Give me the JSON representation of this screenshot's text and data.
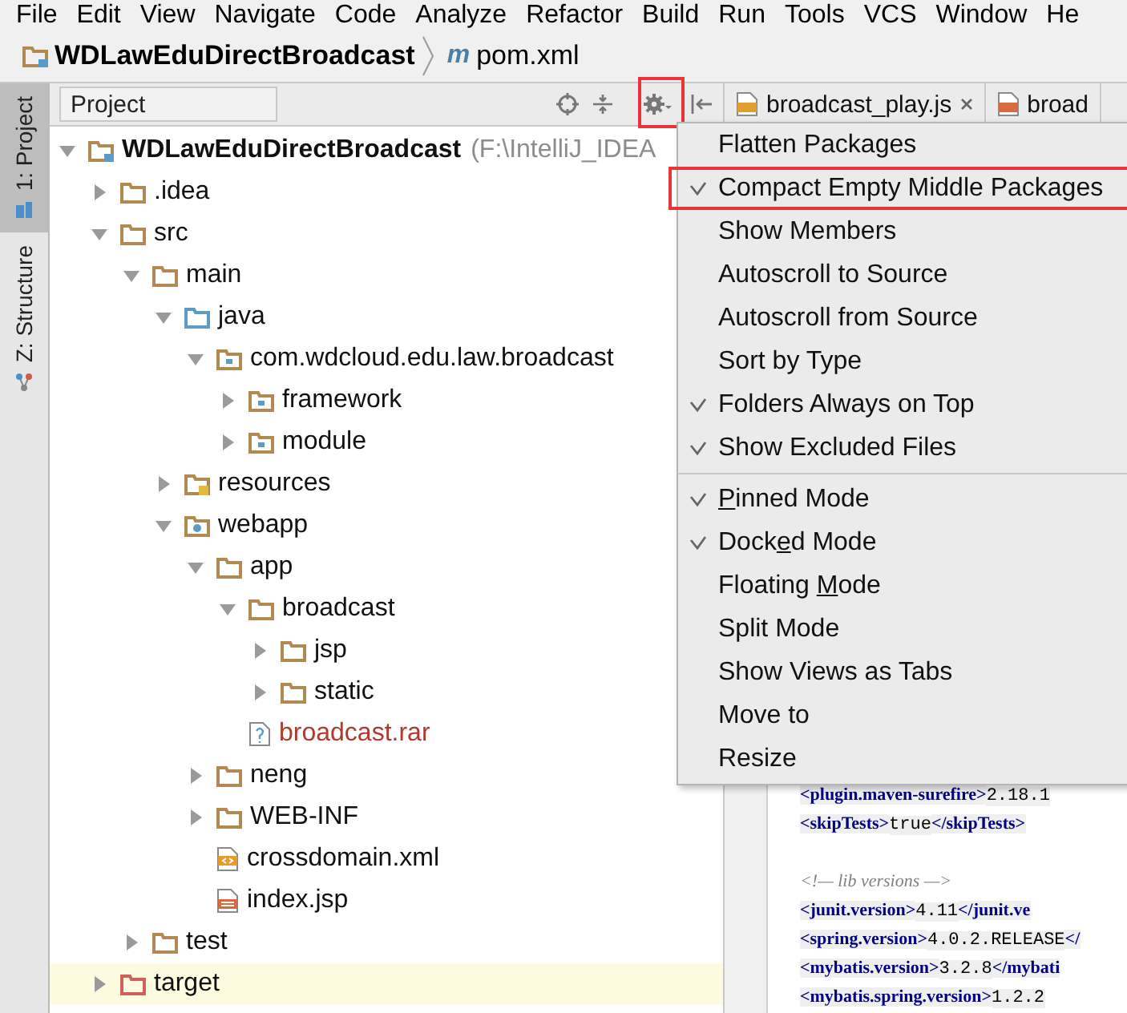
{
  "menu_bar": [
    "File",
    "Edit",
    "View",
    "Navigate",
    "Code",
    "Analyze",
    "Refactor",
    "Build",
    "Run",
    "Tools",
    "VCS",
    "Window",
    "He"
  ],
  "breadcrumbs": [
    {
      "label": "WDLawEduDirectBroadcast"
    },
    {
      "label": "pom.xml",
      "badge": "m"
    }
  ],
  "tool_strip": [
    {
      "label": "1: Project",
      "selected": true
    },
    {
      "label": "Z: Structure",
      "selected": false
    }
  ],
  "project_panel": {
    "view_selector": "Project",
    "gear_highlighted": true,
    "tree": [
      {
        "name": "WDLawEduDirectBroadcast",
        "path": "(F:\\IntelliJ_IDEA",
        "kind": "module",
        "expanded": true,
        "selected": false,
        "children": [
          {
            "name": ".idea",
            "kind": "folder",
            "expanded": false,
            "selected": false
          },
          {
            "name": "src",
            "kind": "folder",
            "expanded": true,
            "selected": false,
            "children": [
              {
                "name": "main",
                "kind": "folder",
                "expanded": true,
                "selected": false,
                "children": [
                  {
                    "name": "java",
                    "kind": "source",
                    "expanded": true,
                    "selected": false,
                    "children": [
                      {
                        "name": "com.wdcloud.edu.law.broadcast",
                        "kind": "package",
                        "expanded": true,
                        "selected": false,
                        "children": [
                          {
                            "name": "framework",
                            "kind": "package",
                            "expanded": false,
                            "selected": false
                          },
                          {
                            "name": "module",
                            "kind": "package",
                            "expanded": false,
                            "selected": false
                          }
                        ]
                      }
                    ]
                  },
                  {
                    "name": "resources",
                    "kind": "resources",
                    "expanded": false,
                    "selected": false
                  },
                  {
                    "name": "webapp",
                    "kind": "web",
                    "expanded": true,
                    "selected": false,
                    "children": [
                      {
                        "name": "app",
                        "kind": "folder",
                        "expanded": true,
                        "selected": false,
                        "children": [
                          {
                            "name": "broadcast",
                            "kind": "folder",
                            "expanded": true,
                            "selected": false,
                            "children": [
                              {
                                "name": "jsp",
                                "kind": "folder",
                                "expanded": false,
                                "selected": false
                              },
                              {
                                "name": "static",
                                "kind": "folder",
                                "expanded": false,
                                "selected": false
                              }
                            ]
                          },
                          {
                            "name": "broadcast.rar",
                            "kind": "unknown",
                            "color": "#b03a2e",
                            "selected": false
                          }
                        ]
                      },
                      {
                        "name": "neng",
                        "kind": "folder",
                        "expanded": false,
                        "selected": false
                      },
                      {
                        "name": "WEB-INF",
                        "kind": "folder",
                        "expanded": false,
                        "selected": false
                      },
                      {
                        "name": "crossdomain.xml",
                        "kind": "xml",
                        "selected": false
                      },
                      {
                        "name": "index.jsp",
                        "kind": "jsp",
                        "selected": false
                      }
                    ]
                  }
                ]
              },
              {
                "name": "test",
                "kind": "folder",
                "expanded": false,
                "selected": false
              }
            ]
          },
          {
            "name": "target",
            "kind": "excluded",
            "expanded": false,
            "selected": true
          }
        ]
      }
    ]
  },
  "editor_tabs": [
    {
      "label": "broadcast_play.js",
      "kind": "js",
      "closable": true
    },
    {
      "label": "broad",
      "kind": "jsp",
      "closable": false
    }
  ],
  "popup_menu": [
    {
      "kind": "item",
      "label": "Flatten Packages",
      "checked": false,
      "highlighted": false
    },
    {
      "kind": "item",
      "label": "Compact Empty Middle Packages",
      "checked": true,
      "highlighted": true
    },
    {
      "kind": "item",
      "label": "Show Members",
      "checked": false,
      "highlighted": false
    },
    {
      "kind": "item",
      "label": "Autoscroll to Source",
      "checked": false,
      "highlighted": false
    },
    {
      "kind": "item",
      "label": "Autoscroll from Source",
      "checked": false,
      "highlighted": false
    },
    {
      "kind": "item",
      "label": "Sort by Type",
      "checked": false,
      "highlighted": false
    },
    {
      "kind": "item",
      "label": "Folders Always on Top",
      "checked": true,
      "highlighted": false
    },
    {
      "kind": "item",
      "label": "Show Excluded Files",
      "checked": true,
      "highlighted": false
    },
    {
      "kind": "separator"
    },
    {
      "kind": "item",
      "label_parts": [
        {
          "text": "P",
          "underline": true
        },
        {
          "text": "inned Mode"
        }
      ],
      "checked": true,
      "highlighted": false
    },
    {
      "kind": "item",
      "label_parts": [
        {
          "text": "Dock"
        },
        {
          "text": "e",
          "underline": true
        },
        {
          "text": "d Mode"
        }
      ],
      "checked": true,
      "highlighted": false
    },
    {
      "kind": "item",
      "label_parts": [
        {
          "text": "Floating "
        },
        {
          "text": "M",
          "underline": true
        },
        {
          "text": "ode"
        }
      ],
      "checked": false,
      "highlighted": false
    },
    {
      "kind": "item",
      "label": "Split Mode",
      "checked": false,
      "highlighted": false
    },
    {
      "kind": "item",
      "label": "Show Views as Tabs",
      "checked": false,
      "highlighted": false
    },
    {
      "kind": "item",
      "label": "Move to",
      "checked": false,
      "highlighted": false
    },
    {
      "kind": "item",
      "label": "Resize",
      "checked": false,
      "highlighted": false
    }
  ],
  "code_lines": [
    {
      "segments": [
        {
          "kind": "tag",
          "text": "<plugin.maven-surefire>"
        },
        {
          "kind": "value",
          "text": "2.18.1"
        }
      ]
    },
    {
      "segments": [
        {
          "kind": "tag",
          "text": "<skipTests>"
        },
        {
          "kind": "value",
          "text": "true"
        },
        {
          "kind": "tag",
          "text": "</skipTests>"
        }
      ]
    },
    {
      "kind": "blank"
    },
    {
      "segments": [
        {
          "kind": "comment",
          "text": "<!— lib versions —>"
        }
      ]
    },
    {
      "segments": [
        {
          "kind": "tag",
          "text": "<junit.version>"
        },
        {
          "kind": "value",
          "text": "4.11"
        },
        {
          "kind": "tag",
          "text": "</junit.ve"
        }
      ]
    },
    {
      "segments": [
        {
          "kind": "tag",
          "text": "<spring.version>"
        },
        {
          "kind": "value",
          "text": "4.0.2.RELEASE"
        },
        {
          "kind": "tag",
          "text": "</"
        }
      ]
    },
    {
      "segments": [
        {
          "kind": "tag",
          "text": "<mybatis.version>"
        },
        {
          "kind": "value",
          "text": "3.2.8"
        },
        {
          "kind": "tag",
          "text": "</mybati"
        }
      ]
    },
    {
      "segments": [
        {
          "kind": "tag",
          "text": "<mybatis.spring.version>"
        },
        {
          "kind": "value",
          "text": "1.2.2"
        }
      ]
    }
  ]
}
